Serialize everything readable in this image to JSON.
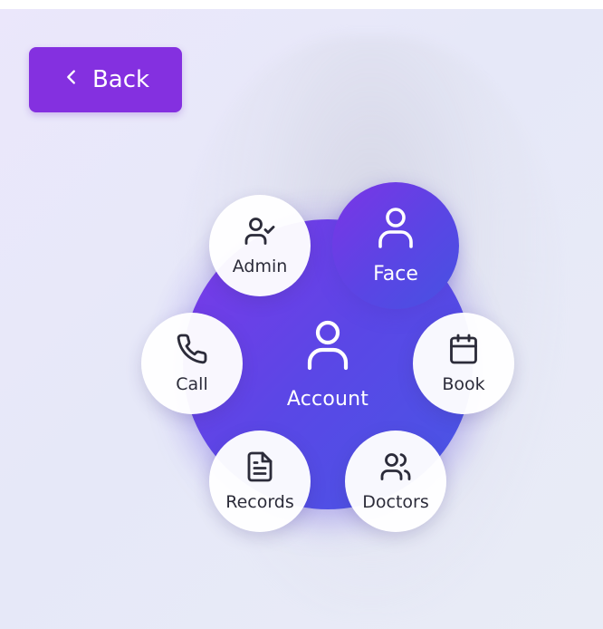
{
  "nav": {
    "back_label": "Back",
    "back_icon": "chevron-left-icon"
  },
  "hub": {
    "label": "Account",
    "icon": "user-icon"
  },
  "menu": {
    "admin": {
      "label": "Admin",
      "icon": "user-check-icon"
    },
    "face": {
      "label": "Face",
      "icon": "user-icon"
    },
    "call": {
      "label": "Call",
      "icon": "phone-icon"
    },
    "book": {
      "label": "Book",
      "icon": "calendar-icon"
    },
    "records": {
      "label": "Records",
      "icon": "file-text-icon"
    },
    "doctors": {
      "label": "Doctors",
      "icon": "users-icon"
    }
  },
  "colors": {
    "accent": "#8430e0",
    "hub_gradient_start": "#7d38e8",
    "hub_gradient_end": "#4657e4",
    "node_bg": "#ffffff",
    "text_dark": "#2c2c3a"
  }
}
